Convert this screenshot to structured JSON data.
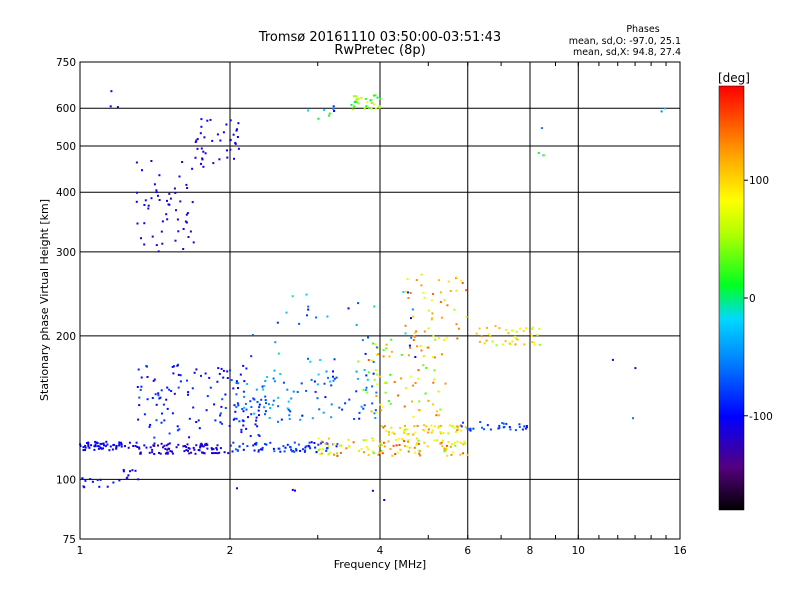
{
  "chart_data": {
    "type": "scatter",
    "title": "Tromsø 20161110 03:50:00-03:51:43",
    "subtitle": "RwPretec (8p)",
    "xlabel": "Frequency [MHz]",
    "ylabel": "Stationary phase Virtual Height [km]",
    "x_scale": "log",
    "y_scale": "log",
    "xlim": [
      1,
      16
    ],
    "ylim": [
      75,
      750
    ],
    "x_ticks": [
      1,
      2,
      4,
      6,
      8,
      10,
      16
    ],
    "x_tick_labels": [
      "1",
      "2",
      "4",
      "6",
      "8",
      "10",
      "16"
    ],
    "y_ticks": [
      75,
      100,
      200,
      300,
      400,
      500,
      600,
      750
    ],
    "y_tick_labels": [
      "75",
      "100",
      "200",
      "300",
      "400",
      "500",
      "600",
      "750"
    ],
    "grid": true,
    "phases": {
      "title": "Phases",
      "line_o": "mean, sd,O: -97.0, 25.1",
      "line_x": "mean, sd,X:  94.8, 27.4"
    },
    "colorbar": {
      "label": "[deg]",
      "ticks": [
        100,
        0,
        -100
      ],
      "tick_labels": [
        "100",
        "0",
        "-100"
      ],
      "range": [
        -180,
        180
      ]
    },
    "clusters": [
      {
        "x": [
          1.0,
          1.3
        ],
        "y": [
          115,
          120
        ],
        "phase": [
          -110,
          -95
        ],
        "n": 55
      },
      {
        "x": [
          1.3,
          2.0
        ],
        "y": [
          113,
          119
        ],
        "phase": [
          -130,
          -100
        ],
        "n": 85
      },
      {
        "x": [
          2.0,
          3.3
        ],
        "y": [
          114,
          120
        ],
        "phase": [
          -120,
          -60
        ],
        "n": 70
      },
      {
        "x": [
          3.0,
          6.0
        ],
        "y": [
          112,
          122
        ],
        "phase": [
          30,
          160
        ],
        "n": 110
      },
      {
        "x": [
          4.0,
          6.0
        ],
        "y": [
          124,
          130
        ],
        "phase": [
          50,
          150
        ],
        "n": 50
      },
      {
        "x": [
          5.8,
          8.0
        ],
        "y": [
          126,
          132
        ],
        "phase": [
          -100,
          -60
        ],
        "n": 30
      },
      {
        "x": [
          1.0,
          1.25
        ],
        "y": [
          96,
          101
        ],
        "phase": [
          -120,
          -90
        ],
        "n": 14
      },
      {
        "x": [
          1.2,
          1.35
        ],
        "y": [
          100,
          105
        ],
        "phase": [
          -120,
          -100
        ],
        "n": 8
      },
      {
        "x": [
          1.3,
          2.3
        ],
        "y": [
          122,
          175
        ],
        "phase": [
          -120,
          -70
        ],
        "n": 120
      },
      {
        "x": [
          2.0,
          4.0
        ],
        "y": [
          130,
          170
        ],
        "phase": [
          -100,
          -20
        ],
        "n": 110
      },
      {
        "x": [
          3.5,
          5.5
        ],
        "y": [
          135,
          205
        ],
        "phase": [
          20,
          150
        ],
        "n": 80
      },
      {
        "x": [
          4.5,
          6.0
        ],
        "y": [
          195,
          270
        ],
        "phase": [
          60,
          150
        ],
        "n": 45
      },
      {
        "x": [
          6.0,
          8.5
        ],
        "y": [
          190,
          210
        ],
        "phase": [
          40,
          140
        ],
        "n": 40
      },
      {
        "x": [
          2.2,
          4.8
        ],
        "y": [
          175,
          250
        ],
        "phase": [
          -120,
          0
        ],
        "n": 35
      },
      {
        "x": [
          1.3,
          1.7
        ],
        "y": [
          300,
          470
        ],
        "phase": [
          -130,
          -100
        ],
        "n": 55
      },
      {
        "x": [
          1.7,
          2.1
        ],
        "y": [
          450,
          570
        ],
        "phase": [
          -120,
          -100
        ],
        "n": 40
      },
      {
        "x": [
          1.15,
          1.2
        ],
        "y": [
          600,
          660
        ],
        "phase": [
          -120,
          -100
        ],
        "n": 3
      },
      {
        "x": [
          2.6,
          3.3
        ],
        "y": [
          570,
          610
        ],
        "phase": [
          -110,
          20
        ],
        "n": 8
      },
      {
        "x": [
          3.5,
          4.0
        ],
        "y": [
          595,
          640
        ],
        "phase": [
          0,
          70
        ],
        "n": 30
      },
      {
        "x": [
          8.3,
          8.6
        ],
        "y": [
          470,
          550
        ],
        "phase": [
          -100,
          60
        ],
        "n": 4
      },
      {
        "x": [
          14.0,
          15.0
        ],
        "y": [
          580,
          600
        ],
        "phase": [
          -50,
          -30
        ],
        "n": 2
      },
      {
        "x": [
          10.0,
          14.0
        ],
        "y": [
          130,
          210
        ],
        "phase": [
          -120,
          -40
        ],
        "n": 3
      },
      {
        "x": [
          2.0,
          4.5
        ],
        "y": [
          88,
          96
        ],
        "phase": [
          -120,
          -80
        ],
        "n": 5
      }
    ]
  }
}
